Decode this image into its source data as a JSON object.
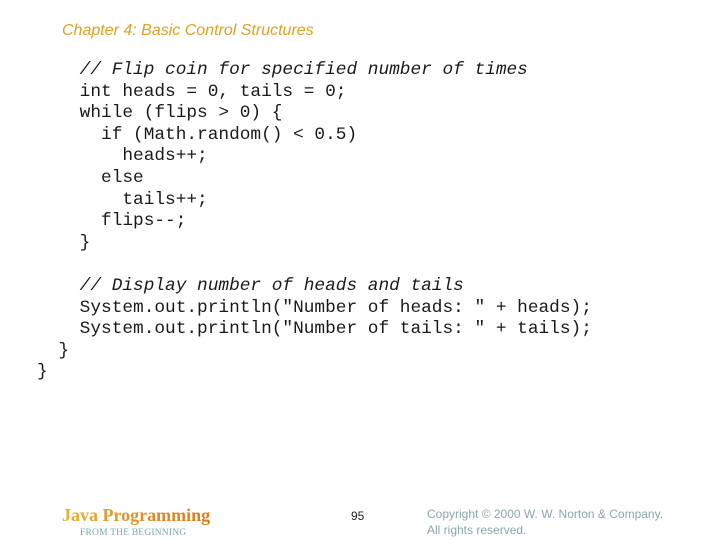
{
  "slide": {
    "title": "Chapter 4: Basic Control Structures",
    "code_lines": [
      {
        "text": "    // Flip coin for specified number of times",
        "comment": true
      },
      {
        "text": "    int heads = 0, tails = 0;",
        "comment": false
      },
      {
        "text": "    while (flips > 0) {",
        "comment": false
      },
      {
        "text": "      if (Math.random() < 0.5)",
        "comment": false
      },
      {
        "text": "        heads++;",
        "comment": false
      },
      {
        "text": "      else",
        "comment": false
      },
      {
        "text": "        tails++;",
        "comment": false
      },
      {
        "text": "      flips--;",
        "comment": false
      },
      {
        "text": "    }",
        "comment": false
      },
      {
        "text": "",
        "comment": false
      },
      {
        "text": "    // Display number of heads and tails",
        "comment": true
      },
      {
        "text": "    System.out.println(\"Number of heads: \" + heads);",
        "comment": false
      },
      {
        "text": "    System.out.println(\"Number of tails: \" + tails);",
        "comment": false
      },
      {
        "text": "  }",
        "comment": false
      },
      {
        "text": "}",
        "comment": false
      }
    ]
  },
  "footer": {
    "brand": "Java Programming",
    "subtitle": "FROM THE BEGINNING",
    "page_number": "95",
    "copyright_line1": "Copyright © 2000 W. W. Norton & Company.",
    "copyright_line2": "All rights reserved."
  }
}
